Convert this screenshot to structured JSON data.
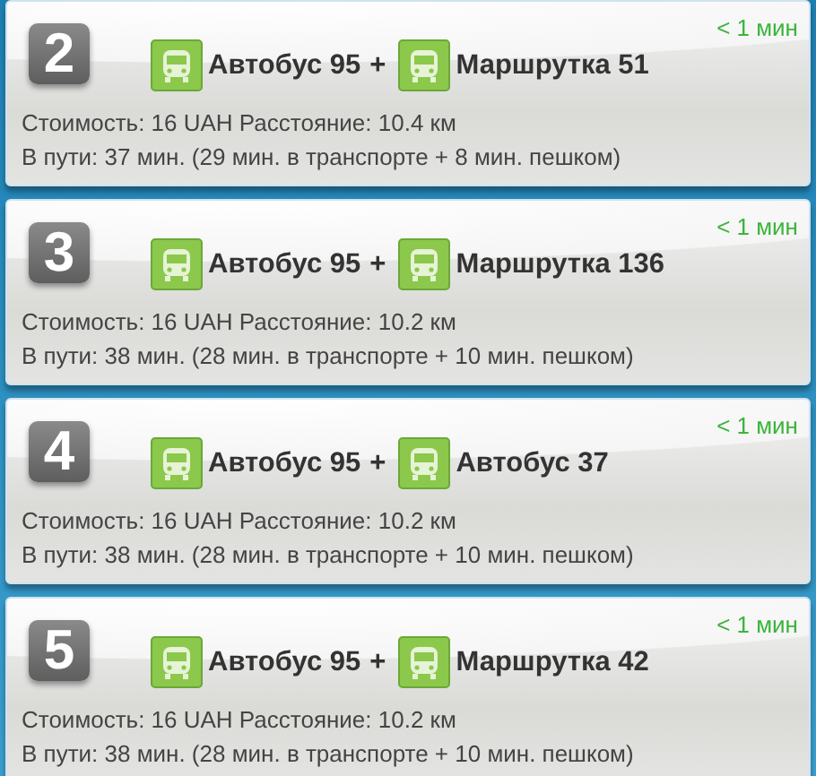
{
  "routes": [
    {
      "number": "2",
      "eta": "< 1 мин",
      "legs": [
        {
          "label": "Автобус 95"
        },
        {
          "label": "Маршрутка 51"
        }
      ],
      "separator": "+",
      "cost": "Стоимость: 16 UAH Расстояние: 10.4 км",
      "duration": "В пути: 37 мин. (29 мин. в транспорте + 8 мин. пешком)"
    },
    {
      "number": "3",
      "eta": "< 1 мин",
      "legs": [
        {
          "label": "Автобус 95"
        },
        {
          "label": "Маршрутка 136"
        }
      ],
      "separator": "+",
      "cost": "Стоимость: 16 UAH Расстояние: 10.2 км",
      "duration": "В пути: 38 мин. (28 мин. в транспорте + 10 мин. пешком)"
    },
    {
      "number": "4",
      "eta": "< 1 мин",
      "legs": [
        {
          "label": "Автобус 95"
        },
        {
          "label": "Автобус 37"
        }
      ],
      "separator": "+",
      "cost": "Стоимость: 16 UAH Расстояние: 10.2 км",
      "duration": "В пути: 38 мин. (28 мин. в транспорте + 10 мин. пешком)"
    },
    {
      "number": "5",
      "eta": "< 1 мин",
      "legs": [
        {
          "label": "Автобус 95"
        },
        {
          "label": "Маршрутка 42"
        }
      ],
      "separator": "+",
      "cost": "Стоимость: 16 UAH Расстояние: 10.2 км",
      "duration": "В пути: 38 мин. (28 мин. в транспорте + 10 мин. пешком)"
    }
  ]
}
